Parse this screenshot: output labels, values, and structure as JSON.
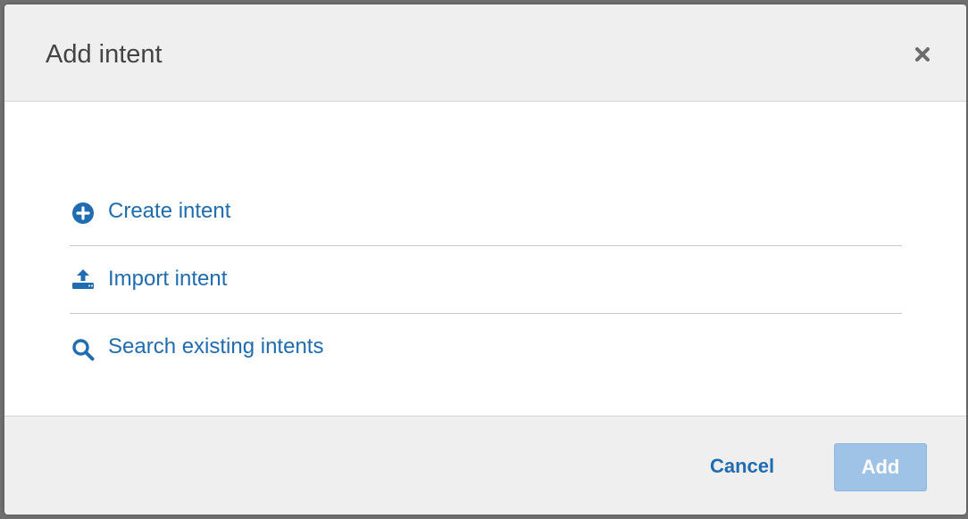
{
  "dialog": {
    "title": "Add intent",
    "close_icon": "close-icon"
  },
  "options": [
    {
      "label": "Create intent",
      "icon": "plus-circle-icon"
    },
    {
      "label": "Import intent",
      "icon": "upload-icon"
    },
    {
      "label": "Search existing intents",
      "icon": "search-icon"
    }
  ],
  "footer": {
    "cancel_label": "Cancel",
    "add_label": "Add",
    "add_disabled": true
  },
  "colors": {
    "link": "#1f6cb1",
    "primary_disabled": "#9fc3e6",
    "header_bg": "#efefef"
  }
}
